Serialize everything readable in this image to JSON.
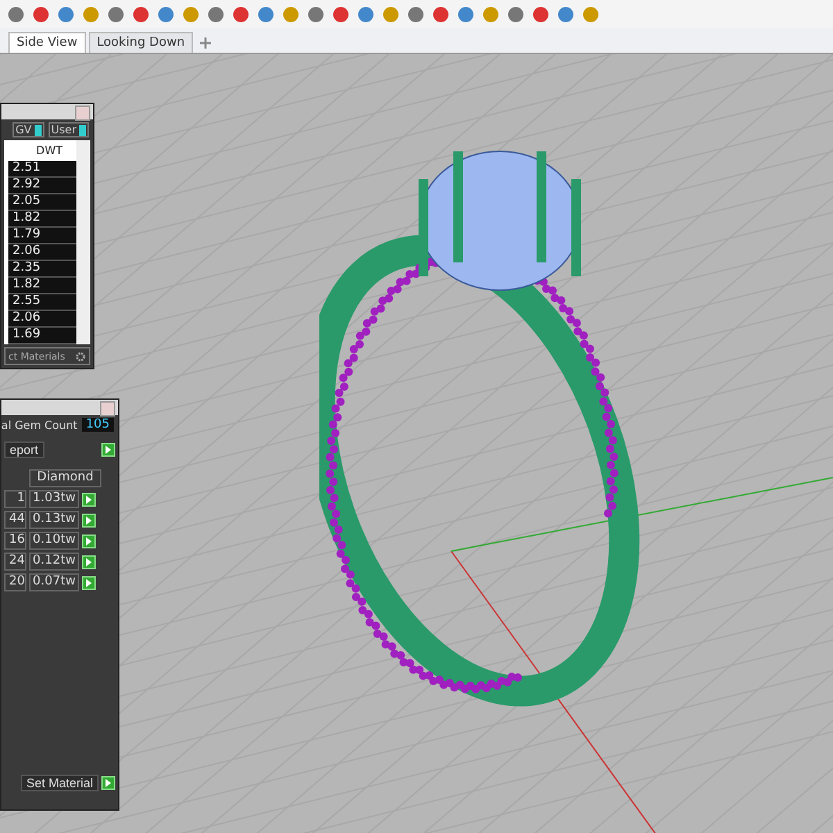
{
  "tabs": [
    {
      "label": "Side View",
      "selected": true
    },
    {
      "label": "Looking Down",
      "selected": false
    }
  ],
  "weight_panel": {
    "toggles": [
      {
        "label": "GV",
        "on": true
      },
      {
        "label": "User",
        "on": true
      }
    ],
    "column": "DWT",
    "values": [
      "2.51",
      "2.92",
      "2.05",
      "1.82",
      "1.79",
      "2.06",
      "2.35",
      "1.82",
      "2.55",
      "2.06",
      "1.69"
    ],
    "dropdown": "ct Materials"
  },
  "gem_panel": {
    "count_label": "al Gem Count",
    "count": "105",
    "report_button": "eport",
    "table_header": "Diamond",
    "rows": [
      {
        "column_1": "1",
        "weight": "1.03tw"
      },
      {
        "column_1": "44",
        "weight": "0.13tw"
      },
      {
        "column_1": "16",
        "weight": "0.10tw"
      },
      {
        "column_1": "24",
        "weight": "0.12tw"
      },
      {
        "column_1": "20",
        "weight": "0.07tw"
      }
    ],
    "set_button": "Set Material"
  }
}
